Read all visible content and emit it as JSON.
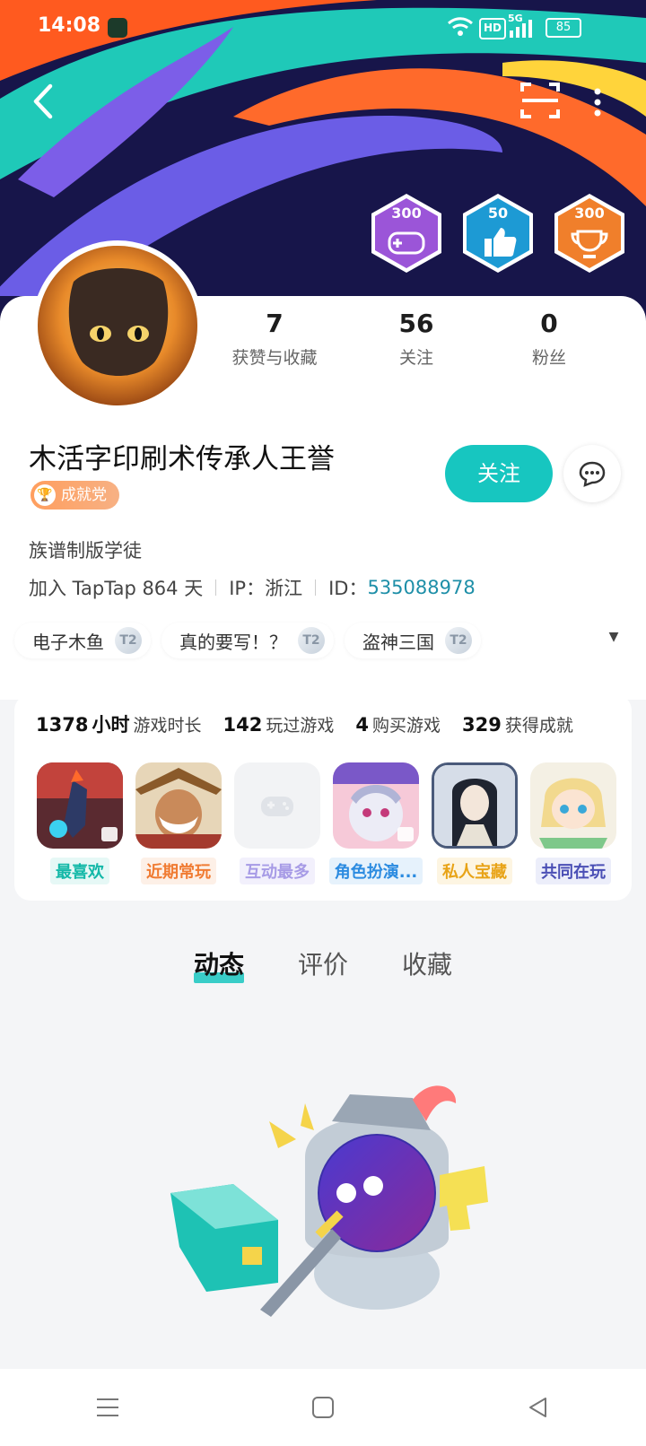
{
  "status_bar": {
    "time": "14:08",
    "wifi_icon": "wifi-icon",
    "hd": "HD",
    "network": "5G",
    "battery": "85"
  },
  "header": {
    "back_icon": "back-arrow-icon",
    "scan_icon": "scan-icon",
    "more_icon": "more-vertical-icon",
    "badges": [
      {
        "number": "300",
        "color": "#9b55d8",
        "icon": "gamepad-icon"
      },
      {
        "number": "50",
        "color": "#1d9ad4",
        "icon": "thumbs-up-icon"
      },
      {
        "number": "300",
        "color": "#f07f2b",
        "icon": "trophy-icon"
      }
    ]
  },
  "profile": {
    "stats": [
      {
        "value": "7",
        "label": "获赞与收藏"
      },
      {
        "value": "56",
        "label": "关注"
      },
      {
        "value": "0",
        "label": "粉丝"
      }
    ],
    "username": "木活字印刷术传承人王誉",
    "achievement_tag": "成就党",
    "follow_label": "关注",
    "bio": "族谱制版学徒",
    "joined": "加入 TapTap 864 天",
    "ip": "IP：浙江",
    "id_label": "ID：",
    "id_value": "535088978",
    "game_tags": [
      {
        "name": "电子木鱼",
        "tier": "T2"
      },
      {
        "name": "真的要写！？",
        "tier": "T2"
      },
      {
        "name": "盗神三国",
        "tier": "T2"
      }
    ]
  },
  "game_summary": {
    "playtime_value": "1378",
    "playtime_unit": "小时",
    "playtime_label": "游戏时长",
    "played_value": "142",
    "played_label": "玩过游戏",
    "bought_value": "4",
    "bought_label": "购买游戏",
    "achv_value": "329",
    "achv_label": "获得成就",
    "games": [
      {
        "label": "最喜欢",
        "color": "#13b8a8",
        "bg": "#e6f8f6"
      },
      {
        "label": "近期常玩",
        "color": "#f07b32",
        "bg": "#fdf0e7"
      },
      {
        "label": "互动最多",
        "color": "#a79be6",
        "bg": "#f2f0fc"
      },
      {
        "label": "角色扮演...",
        "color": "#2b8be0",
        "bg": "#e6f2fc"
      },
      {
        "label": "私人宝藏",
        "color": "#e8a316",
        "bg": "#fdf5e2"
      },
      {
        "label": "共同在玩",
        "color": "#4a4fb5",
        "bg": "#eceefa"
      }
    ]
  },
  "tabs": [
    {
      "label": "动态",
      "active": true
    },
    {
      "label": "评价",
      "active": false
    },
    {
      "label": "收藏",
      "active": false
    }
  ]
}
